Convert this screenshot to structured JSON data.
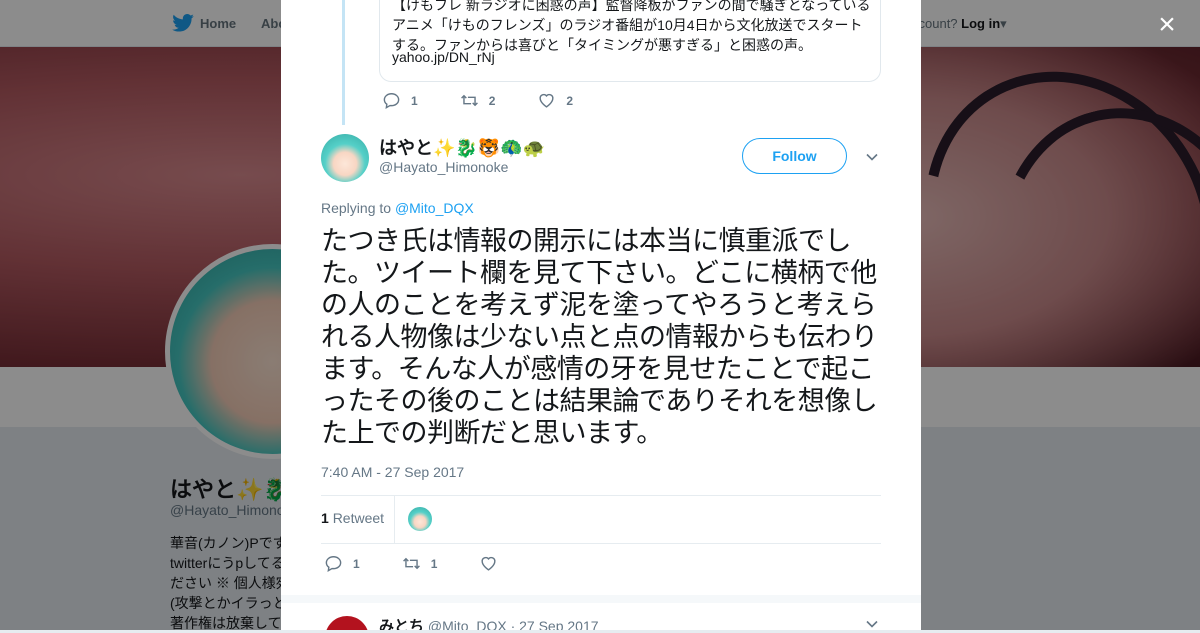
{
  "nav": {
    "home_label": "Home",
    "about_label": "Abo",
    "account_prompt": "ccount?",
    "login_label": "Log in"
  },
  "background_profile": {
    "name": "はやと✨🐉🐯🦚🐢",
    "handle": "@Hayato_Himono",
    "bio_lines": [
      "華音(カノン)Pです",
      "twitterにうpしてる",
      "ださい ※ 個人様宛",
      "(攻撃とかイラっと",
      "著作権は放棄して"
    ]
  },
  "modal": {
    "close_label": "×",
    "quoted": {
      "text": "【けもフレ 新ラジオに困惑の声】監督降板がファンの間で騒ぎとなっているアニメ「けものフレンズ」のラジオ番組が10月4日から文化放送でスタートする。ファンからは喜びと「タイミングが悪すぎる」と困惑の声。",
      "link": "yahoo.jp/DN_rNj",
      "replies": "1",
      "retweets": "2",
      "likes": "2"
    },
    "tweet": {
      "author_name": "はやと✨🐉🐯🦚🐢",
      "author_handle": "@Hayato_Himonoke",
      "follow_label": "Follow",
      "replying_prefix": "Replying to ",
      "replying_to": "@Mito_DQX",
      "text": "たつき氏は情報の開示には本当に慎重派でした。ツイート欄を見て下さい。どこに横柄で他の人のことを考えず泥を塗ってやろうと考えられる人物像は少ない点と点の情報からも伝わります。そんな人が感情の牙を見せたことで起こったその後のことは結果論でありそれを想像した上での判断だと思います。",
      "timestamp": "7:40 AM - 27 Sep 2017",
      "retweet_count": "1",
      "retweet_label": "Retweet",
      "replies": "1",
      "retweets": "1",
      "likes": ""
    },
    "next_reply": {
      "name": "みとち",
      "handle_date": "@Mito_DQX · 27 Sep 2017"
    }
  },
  "colors": {
    "accent": "#1da1f2",
    "text": "#14171a",
    "muted": "#657786"
  }
}
